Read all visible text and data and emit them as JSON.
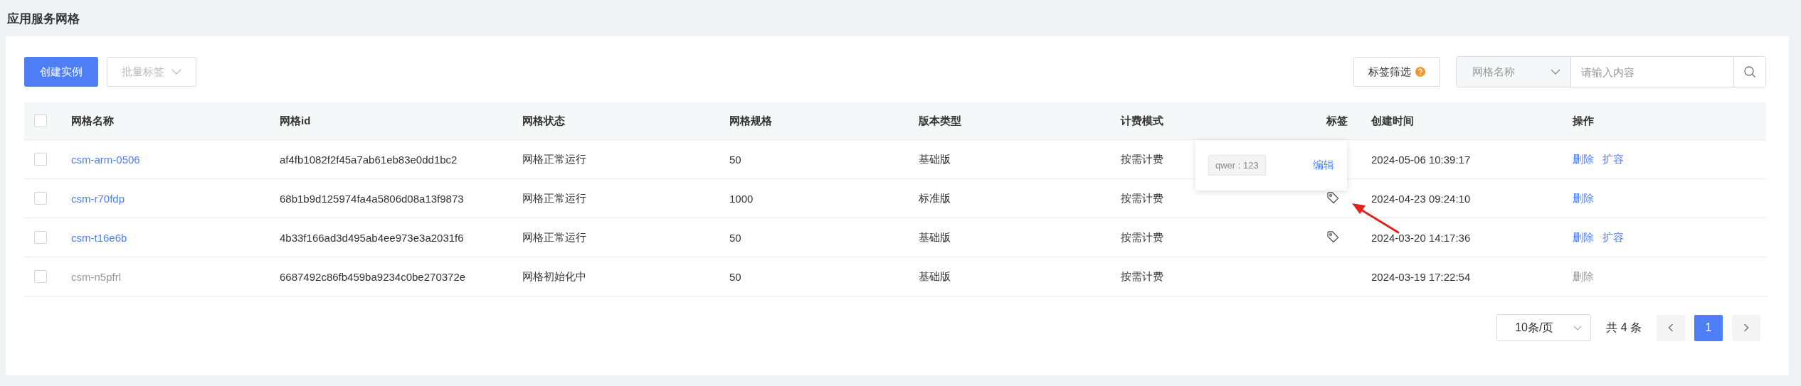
{
  "page_title": "应用服务网格",
  "toolbar": {
    "create_button": "创建实例",
    "batch_button": {
      "label": "批量标签",
      "disabled": true
    },
    "tag_filter": "标签筛选",
    "search_field": {
      "selected": "网格名称",
      "placeholder": "请输入内容"
    }
  },
  "table": {
    "all_checked": false,
    "columns": [
      "网格名称",
      "网格id",
      "网格状态",
      "网格规格",
      "版本类型",
      "计费模式",
      "标签",
      "创建时间",
      "操作"
    ],
    "rows": [
      {
        "checked": false,
        "name": "csm-arm-0506",
        "disabled": false,
        "id": "af4fb1082f2f45a7ab61eb83e0dd1bc2",
        "status": "网格正常运行",
        "spec": "50",
        "version": "基础版",
        "billing": "按需计费",
        "has_tag": false,
        "created": "2024-05-06 10:39:17",
        "actions": [
          {
            "label": "删除",
            "disabled": false
          },
          {
            "label": "扩容",
            "disabled": false
          }
        ]
      },
      {
        "checked": false,
        "name": "csm-r70fdp",
        "disabled": false,
        "id": "68b1b9d125974fa4a5806d08a13f9873",
        "status": "网格正常运行",
        "spec": "1000",
        "version": "标准版",
        "billing": "按需计费",
        "has_tag": true,
        "created": "2024-04-23 09:24:10",
        "actions": [
          {
            "label": "删除",
            "disabled": false
          }
        ]
      },
      {
        "checked": false,
        "name": "csm-t16e6b",
        "disabled": false,
        "id": "4b33f166ad3d495ab4ee973e3a2031f6",
        "status": "网格正常运行",
        "spec": "50",
        "version": "基础版",
        "billing": "按需计费",
        "has_tag": true,
        "created": "2024-03-20 14:17:36",
        "actions": [
          {
            "label": "删除",
            "disabled": false
          },
          {
            "label": "扩容",
            "disabled": false
          }
        ]
      },
      {
        "checked": false,
        "name": "csm-n5pfrl",
        "disabled": true,
        "id": "6687492c86fb459ba9234c0be270372e",
        "status": "网格初始化中",
        "spec": "50",
        "version": "基础版",
        "billing": "按需计费",
        "has_tag": false,
        "created": "2024-03-19 17:22:54",
        "actions": [
          {
            "label": "删除",
            "disabled": true
          }
        ]
      }
    ],
    "tag_popover": {
      "tag": "qwer : 123",
      "edit_link": "编辑"
    }
  },
  "pagination": {
    "page_size": "10条/页",
    "total": "共 4 条",
    "pages": [
      {
        "label": "1",
        "selected": true
      }
    ]
  }
}
